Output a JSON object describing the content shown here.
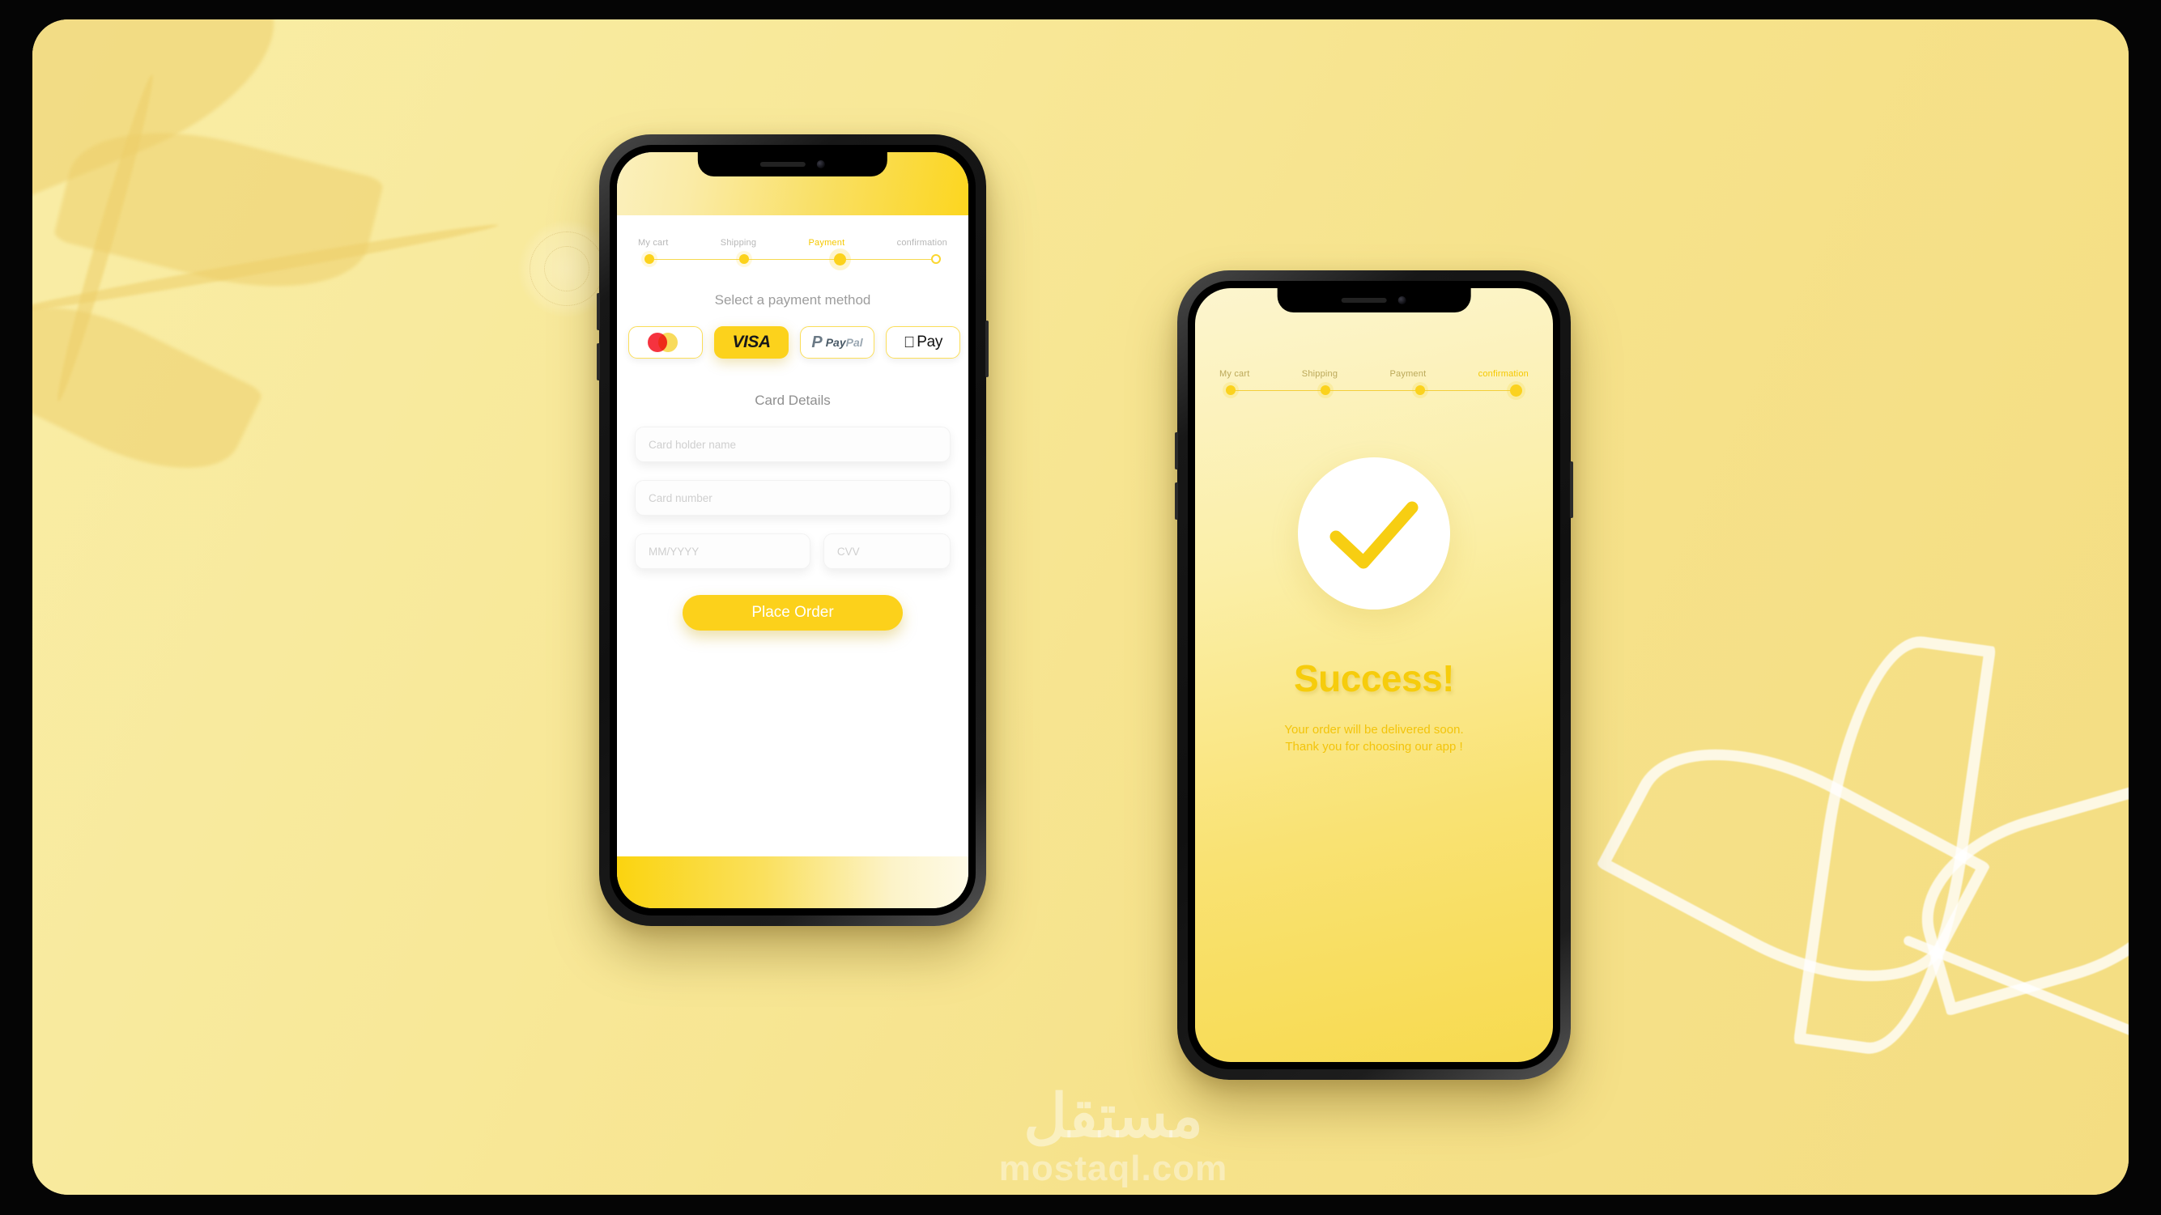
{
  "theme": {
    "accent": "#FCD21C",
    "accent_deep": "#F5C800",
    "canvas_bg": "#F7E693",
    "text_muted": "#b7b7b7"
  },
  "watermark": {
    "arabic": "مستقل",
    "latin": "mostaql.com"
  },
  "phone1": {
    "screen_name": "payment-screen",
    "stepper": {
      "steps": [
        {
          "label": "My cart",
          "state": "done"
        },
        {
          "label": "Shipping",
          "state": "done"
        },
        {
          "label": "Payment",
          "state": "active"
        },
        {
          "label": "confirmation",
          "state": "pending"
        }
      ]
    },
    "payment_section_title": "Select a payment method",
    "payment_methods": [
      {
        "name": "mastercard",
        "label": "Mastercard",
        "selected": false
      },
      {
        "name": "visa",
        "label": "VISA",
        "selected": true
      },
      {
        "name": "paypal",
        "label": "PayPal",
        "selected": false
      },
      {
        "name": "applepay",
        "label": "Pay",
        "selected": false
      }
    ],
    "card_details_title": "Card Details",
    "fields": [
      {
        "name": "card-holder-name",
        "placeholder": "Card holder name",
        "value": ""
      },
      {
        "name": "card-number",
        "placeholder": "Card number",
        "value": ""
      },
      {
        "name": "expiry",
        "placeholder": "MM/YYYY",
        "value": ""
      },
      {
        "name": "cvv",
        "placeholder": "CVV",
        "value": ""
      }
    ],
    "submit_label": "Place Order"
  },
  "phone2": {
    "screen_name": "success-screen",
    "stepper": {
      "steps": [
        {
          "label": "My cart",
          "state": "done"
        },
        {
          "label": "Shipping",
          "state": "done"
        },
        {
          "label": "Payment",
          "state": "done"
        },
        {
          "label": "confirmation",
          "state": "active"
        }
      ]
    },
    "success_title": "Success!",
    "success_line1": "Your order will be delivered soon.",
    "success_line2": "Thank you for choosing our app !"
  }
}
